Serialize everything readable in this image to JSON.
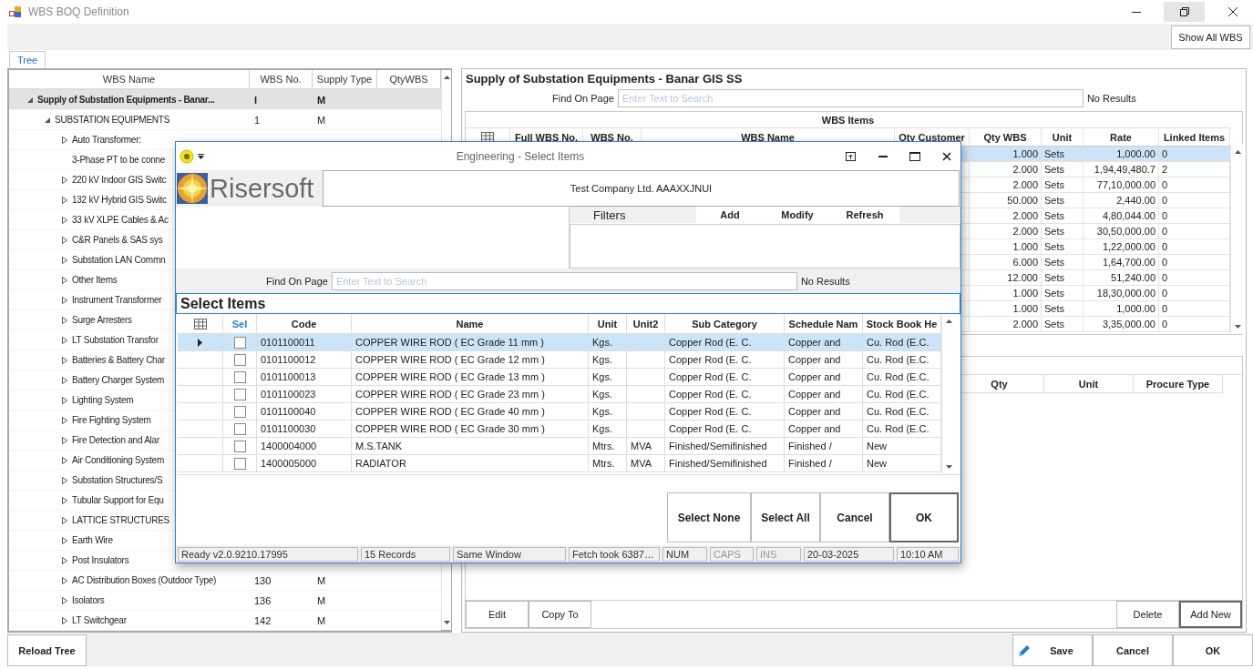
{
  "window": {
    "title": "WBS BOQ Definition"
  },
  "toolbar": {
    "show_all_button": "Show All WBS"
  },
  "tabs": [
    {
      "label": "Tree",
      "selected": true
    }
  ],
  "tree": {
    "columns": [
      "WBS Name",
      "WBS No.",
      "Supply Type",
      "QtyWBS"
    ],
    "rows": [
      {
        "name": "Supply of Substation Equipments - Banar...",
        "wbs_no": "I",
        "supply_type": "M",
        "kind": "group",
        "expanded": true,
        "selected": true,
        "children": [
          {
            "name": "SUBSTATION EQUIPMENTS",
            "wbs_no": "1",
            "supply_type": "M",
            "kind": "group",
            "expanded": true,
            "selected": false,
            "children": [
              {
                "name": "Auto Transformer:",
                "kind": "group",
                "expanded": false,
                "selected": false
              },
              {
                "name": "3-Phase PT to be conne",
                "kind": "leaf",
                "selected": false
              },
              {
                "name": "220 kV Indoor GIS Switc",
                "kind": "group",
                "expanded": false,
                "selected": false
              },
              {
                "name": "132 kV Hybrid GIS Switc",
                "kind": "group",
                "expanded": false,
                "selected": false
              },
              {
                "name": "33 kV XLPE Cables & Ac",
                "kind": "group",
                "expanded": false,
                "selected": false
              },
              {
                "name": "C&R Panels & SAS sys",
                "kind": "group",
                "expanded": false,
                "selected": false
              },
              {
                "name": "Substation LAN Commn",
                "kind": "group",
                "expanded": false,
                "selected": false
              },
              {
                "name": "Other Items",
                "kind": "group",
                "expanded": false,
                "selected": false
              },
              {
                "name": "Instrument Transformer",
                "kind": "group",
                "expanded": false,
                "selected": false
              },
              {
                "name": "Surge Arresters",
                "kind": "group",
                "expanded": false,
                "selected": false
              },
              {
                "name": "LT Substation Transfor",
                "kind": "group",
                "expanded": false,
                "selected": false
              },
              {
                "name": "Batteries & Battery Char",
                "kind": "group",
                "expanded": false,
                "selected": false
              },
              {
                "name": "Battery Charger System",
                "kind": "group",
                "expanded": false,
                "selected": false
              },
              {
                "name": "Lighting System",
                "kind": "group",
                "expanded": false,
                "selected": false
              },
              {
                "name": "Fire Fighting System",
                "kind": "group",
                "expanded": false,
                "selected": false
              },
              {
                "name": "Fire Detection and Alar",
                "kind": "group",
                "expanded": false,
                "selected": false
              },
              {
                "name": "Air Conditioning System",
                "kind": "group",
                "expanded": false,
                "selected": false
              },
              {
                "name": "Substation Structures/S",
                "kind": "group",
                "expanded": false,
                "selected": false
              },
              {
                "name": "Tubular Support for Equ",
                "kind": "group",
                "expanded": false,
                "selected": false
              },
              {
                "name": "LATTICE STRUCTURES",
                "kind": "group",
                "expanded": false,
                "selected": false
              },
              {
                "name": "Earth Wire",
                "kind": "group",
                "expanded": false,
                "selected": false
              },
              {
                "name": "Post Insulators",
                "kind": "group",
                "expanded": false,
                "selected": false
              },
              {
                "name": "AC Distribution Boxes (Outdoor Type)",
                "wbs_no": "130",
                "supply_type": "M",
                "kind": "group",
                "expanded": false,
                "selected": false
              },
              {
                "name": "Isolators",
                "wbs_no": "136",
                "supply_type": "M",
                "kind": "group",
                "expanded": false,
                "selected": false
              },
              {
                "name": "LT Switchgear",
                "wbs_no": "142",
                "supply_type": "M",
                "kind": "group",
                "expanded": false,
                "selected": false
              }
            ]
          }
        ]
      }
    ]
  },
  "detail": {
    "title": "Supply of Substation Equipments - Banar GIS SS",
    "find": {
      "label": "Find On Page",
      "placeholder": "Enter Text to Search",
      "result": "No Results"
    },
    "wbs_items": {
      "title": "WBS Items",
      "columns": [
        "Full WBS No.",
        "WBS No.",
        "WBS Name",
        "Qty Customer",
        "Qty WBS",
        "Unit",
        "Rate",
        "Linked Items"
      ],
      "rows": [
        {
          "qty_wbs": "1.000",
          "unit": "Sets",
          "rate": "1,000.00",
          "linked_items": "0",
          "selected": true
        },
        {
          "qty_wbs": "2.000",
          "unit": "Sets",
          "rate": "1,94,49,480.7",
          "linked_items": "2",
          "selected": false
        },
        {
          "qty_wbs": "2.000",
          "unit": "Sets",
          "rate": "77,10,000.00",
          "linked_items": "0",
          "selected": false
        },
        {
          "qty_wbs": "50.000",
          "unit": "Sets",
          "rate": "2,440.00",
          "linked_items": "0",
          "selected": false
        },
        {
          "qty_wbs": "2.000",
          "unit": "Sets",
          "rate": "4,80,044.00",
          "linked_items": "0",
          "selected": false
        },
        {
          "qty_wbs": "2.000",
          "unit": "Sets",
          "rate": "30,50,000.00",
          "linked_items": "0",
          "selected": false
        },
        {
          "qty_wbs": "1.000",
          "unit": "Sets",
          "rate": "1,22,000.00",
          "linked_items": "0",
          "selected": false
        },
        {
          "qty_wbs": "6.000",
          "unit": "Sets",
          "rate": "1,64,700.00",
          "linked_items": "0",
          "selected": false
        },
        {
          "qty_wbs": "12.000",
          "unit": "Sets",
          "rate": "51,240.00",
          "linked_items": "0",
          "selected": false
        },
        {
          "qty_wbs": "1.000",
          "unit": "Sets",
          "rate": "18,30,000.00",
          "linked_items": "0",
          "selected": false
        },
        {
          "qty_wbs": "1.000",
          "unit": "Sets",
          "rate": "1,000.00",
          "linked_items": "0",
          "selected": false
        },
        {
          "qty_wbs": "2.000",
          "unit": "Sets",
          "rate": "3,35,000.00",
          "linked_items": "0",
          "selected": false
        }
      ]
    },
    "lower_grid": {
      "columns": [
        "Qty",
        "Unit",
        "Procure Type"
      ]
    },
    "buttons_left": [
      "Edit",
      "Copy To"
    ],
    "buttons_right": [
      "Delete",
      "Add New"
    ]
  },
  "bottom_bar": {
    "reload_button": "Reload Tree",
    "actions": [
      {
        "label": "Save",
        "kind": "save"
      },
      {
        "label": "Cancel",
        "kind": "plain"
      },
      {
        "label": "OK",
        "kind": "plain"
      }
    ]
  },
  "dialog": {
    "title": "Engineering - Select Items",
    "brand": "Risersoft",
    "company": "Test Company Ltd. AAAXXJNUI",
    "filters": {
      "title": "Filters",
      "actions": [
        "Add",
        "Modify",
        "Refresh"
      ]
    },
    "find": {
      "label": "Find On Page",
      "placeholder": "Enter Text to Search",
      "result": "No Results"
    },
    "heading": "Select Items",
    "columns": [
      "Sel",
      "Code",
      "Name",
      "Unit",
      "Unit2",
      "Sub Category",
      "Schedule Nam",
      "Stock Book He"
    ],
    "rows": [
      {
        "code": "0101100011",
        "name": "COPPER WIRE ROD ( EC Grade 11 mm )",
        "unit": "Kgs.",
        "unit2": "",
        "sub_category": "Copper Rod (E. C.",
        "schedule": "Copper and",
        "stock_book": "Cu. Rod (E.C.",
        "checked": false,
        "selected": true
      },
      {
        "code": "0101100012",
        "name": "COPPER WIRE ROD ( EC Grade 12 mm )",
        "unit": "Kgs.",
        "unit2": "",
        "sub_category": "Copper Rod (E. C.",
        "schedule": "Copper and",
        "stock_book": "Cu. Rod (E.C.",
        "checked": false,
        "selected": false
      },
      {
        "code": "0101100013",
        "name": "COPPER WIRE ROD ( EC Grade 13 mm )",
        "unit": "Kgs.",
        "unit2": "",
        "sub_category": "Copper Rod (E. C.",
        "schedule": "Copper and",
        "stock_book": "Cu. Rod (E.C.",
        "checked": false,
        "selected": false
      },
      {
        "code": "0101100023",
        "name": "COPPER WIRE ROD ( EC Grade 23 mm )",
        "unit": "Kgs.",
        "unit2": "",
        "sub_category": "Copper Rod (E. C.",
        "schedule": "Copper and",
        "stock_book": "Cu. Rod (E.C.",
        "checked": false,
        "selected": false
      },
      {
        "code": "0101100040",
        "name": "COPPER WIRE ROD ( EC Grade 40 mm )",
        "unit": "Kgs.",
        "unit2": "",
        "sub_category": "Copper Rod (E. C.",
        "schedule": "Copper and",
        "stock_book": "Cu. Rod (E.C.",
        "checked": false,
        "selected": false
      },
      {
        "code": "0101100030",
        "name": "COPPER WIRE ROD ( EC Grade 30 mm )",
        "unit": "Kgs.",
        "unit2": "",
        "sub_category": "Copper Rod (E. C.",
        "schedule": "Copper and",
        "stock_book": "Cu. Rod (E.C.",
        "checked": false,
        "selected": false
      },
      {
        "code": "1400004000",
        "name": "M.S.TANK",
        "unit": "Mtrs.",
        "unit2": "MVA",
        "sub_category": "Finished/Semifinished",
        "schedule": "Finished /",
        "stock_book": "New",
        "checked": false,
        "selected": false
      },
      {
        "code": "1400005000",
        "name": "RADIATOR",
        "unit": "Mtrs.",
        "unit2": "MVA",
        "sub_category": "Finished/Semifinished",
        "schedule": "Finished /",
        "stock_book": "New",
        "checked": false,
        "selected": false
      }
    ],
    "buttons": [
      "Select None",
      "Select All",
      "Cancel",
      "OK"
    ],
    "status": [
      {
        "text": "Ready v2.0.9210.17995",
        "on": true
      },
      {
        "text": "15 Records",
        "on": true
      },
      {
        "text": "Same Window",
        "on": true
      },
      {
        "text": "Fetch took 6387…",
        "on": true
      },
      {
        "text": "NUM",
        "on": true
      },
      {
        "text": "CAPS",
        "on": false
      },
      {
        "text": "INS",
        "on": false
      },
      {
        "text": "20-03-2025",
        "on": true
      },
      {
        "text": "10:10 AM",
        "on": true
      }
    ]
  }
}
